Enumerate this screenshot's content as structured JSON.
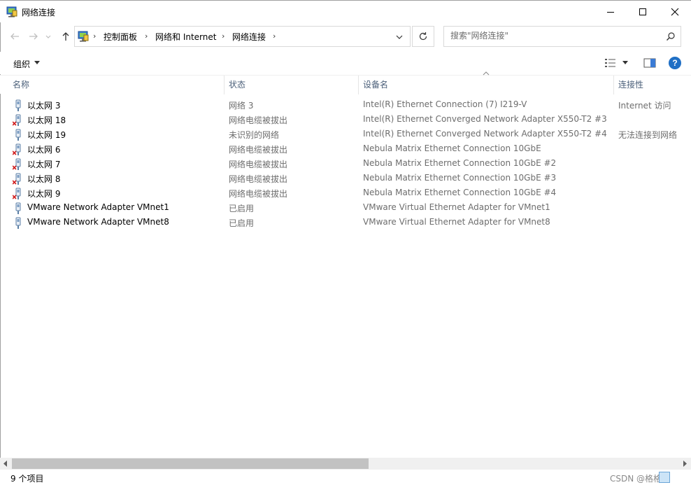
{
  "window": {
    "title": "网络连接"
  },
  "address": {
    "crumbs": [
      "控制面板",
      "网络和 Internet",
      "网络连接"
    ]
  },
  "search": {
    "placeholder": "搜索\"网络连接\""
  },
  "commandbar": {
    "organize_label": "组织"
  },
  "columns": {
    "name": "名称",
    "status": "状态",
    "device": "设备名",
    "connectivity": "连接性"
  },
  "rows": [
    {
      "name": "以太网 3",
      "status": "网络 3",
      "device": "Intel(R) Ethernet Connection (7) I219-V",
      "connectivity": "Internet 访问",
      "icon": "network-adapter-connected-icon"
    },
    {
      "name": "以太网 18",
      "status": "网络电缆被拔出",
      "device": "Intel(R) Ethernet Converged Network Adapter X550-T2 #3",
      "connectivity": "",
      "icon": "network-adapter-unplugged-icon"
    },
    {
      "name": "以太网 19",
      "status": "未识别的网络",
      "device": "Intel(R) Ethernet Converged Network Adapter X550-T2 #4",
      "connectivity": "无法连接到网络",
      "icon": "network-adapter-connected-icon"
    },
    {
      "name": "以太网 6",
      "status": "网络电缆被拔出",
      "device": "Nebula Matrix Ethernet Connection 10GbE",
      "connectivity": "",
      "icon": "network-adapter-unplugged-icon"
    },
    {
      "name": "以太网 7",
      "status": "网络电缆被拔出",
      "device": "Nebula Matrix Ethernet Connection 10GbE #2",
      "connectivity": "",
      "icon": "network-adapter-unplugged-icon"
    },
    {
      "name": "以太网 8",
      "status": "网络电缆被拔出",
      "device": "Nebula Matrix Ethernet Connection 10GbE #3",
      "connectivity": "",
      "icon": "network-adapter-unplugged-icon"
    },
    {
      "name": "以太网 9",
      "status": "网络电缆被拔出",
      "device": "Nebula Matrix Ethernet Connection 10GbE #4",
      "connectivity": "",
      "icon": "network-adapter-unplugged-icon"
    },
    {
      "name": "VMware Network Adapter VMnet1",
      "status": "已启用",
      "device": "VMware Virtual Ethernet Adapter for VMnet1",
      "connectivity": "",
      "icon": "network-adapter-connected-icon"
    },
    {
      "name": "VMware Network Adapter VMnet8",
      "status": "已启用",
      "device": "VMware Virtual Ethernet Adapter for VMnet8",
      "connectivity": "",
      "icon": "network-adapter-connected-icon"
    }
  ],
  "statusbar": {
    "item_count": "9 个项目",
    "watermark": "CSDN @格格不"
  },
  "colors": {
    "header_text": "#4c607a",
    "secondary_text": "#6d6d6d",
    "help_blue": "#1f6fc5",
    "unplugged_x": "#d11f1f"
  },
  "icons": {
    "back": "back-arrow-icon",
    "forward": "forward-arrow-icon",
    "recent": "chevron-down-icon",
    "up": "up-arrow-icon",
    "refresh": "refresh-icon",
    "search": "search-icon",
    "help": "help-icon"
  }
}
